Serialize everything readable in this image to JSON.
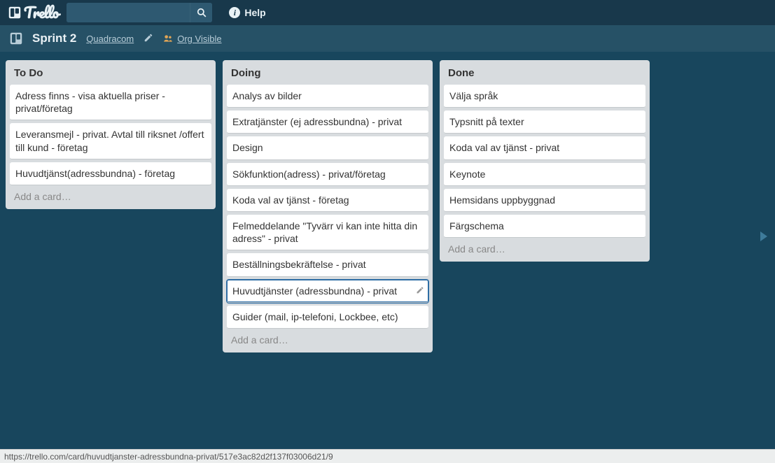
{
  "header": {
    "logo_text": "Trello",
    "help_label": "Help"
  },
  "board_header": {
    "title": "Sprint 2",
    "org": "Quadracom",
    "visibility": "Org Visible"
  },
  "lists": [
    {
      "title": "To Do",
      "cards": [
        "Adress finns - visa aktuella priser - privat/företag",
        "Leveransmejl - privat. Avtal till riksnet /offert till kund - företag",
        "Huvudtjänst(adressbundna) - företag"
      ],
      "hovered_index": -1
    },
    {
      "title": "Doing",
      "cards": [
        "Analys av bilder",
        "Extratjänster (ej adressbundna) - privat",
        "Design",
        "Sökfunktion(adress) - privat/företag",
        "Koda val av tjänst - företag",
        "Felmeddelande \"Tyvärr vi kan inte hitta din adress\" - privat",
        "Beställningsbekräftelse - privat",
        "Huvudtjänster (adressbundna) - privat",
        "Guider (mail, ip-telefoni, Lockbee, etc)"
      ],
      "hovered_index": 7
    },
    {
      "title": "Done",
      "cards": [
        "Välja språk",
        "Typsnitt på texter",
        "Koda val av tjänst - privat",
        "Keynote",
        "Hemsidans uppbyggnad",
        "Färgschema"
      ],
      "hovered_index": -1
    }
  ],
  "add_card_label": "Add a card…",
  "status_bar": "https://trello.com/card/huvudtjanster-adressbundna-privat/517e3ac82d2f137f03006d21/9"
}
